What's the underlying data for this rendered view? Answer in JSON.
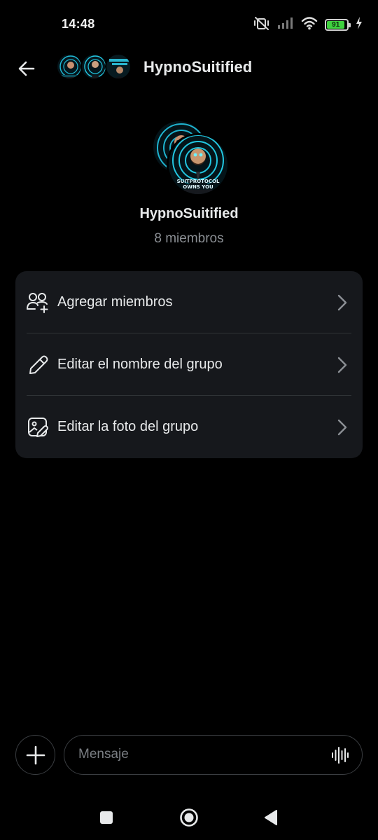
{
  "status_bar": {
    "time": "14:48",
    "battery": "91",
    "icons": [
      "mute-vibrate-icon",
      "signal-icon",
      "wifi-icon",
      "battery-icon",
      "charging-icon"
    ]
  },
  "header": {
    "title": "HypnoSuitified",
    "back_icon": "arrow-left-icon"
  },
  "group": {
    "name": "HypnoSuitified",
    "members": "8 miembros",
    "avatar_caption_1": "SUITPROTOCOL",
    "avatar_caption_2": "OWNS YOU"
  },
  "menu": {
    "items": [
      {
        "label": "Agregar miembros",
        "icon": "add-member-icon"
      },
      {
        "label": "Editar el nombre del grupo",
        "icon": "pencil-icon"
      },
      {
        "label": "Editar la foto del grupo",
        "icon": "edit-photo-icon"
      }
    ]
  },
  "composer": {
    "placeholder": "Mensaje",
    "plus_icon": "plus-icon",
    "voice_icon": "voice-wave-icon"
  },
  "colors": {
    "background": "#000000",
    "card": "#16181c",
    "text": "#e7e9ea",
    "muted": "#8b8f94",
    "divider": "#2f3336",
    "battery": "#3fd13f"
  }
}
